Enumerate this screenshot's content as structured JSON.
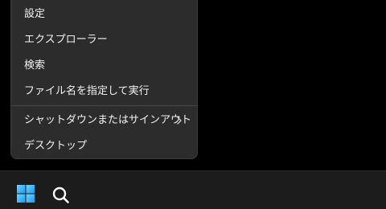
{
  "context_menu": {
    "items": [
      {
        "label": "設定"
      },
      {
        "label": "エクスプローラー"
      },
      {
        "label": "検索"
      },
      {
        "label": "ファイル名を指定して実行"
      },
      {
        "label": "シャットダウンまたはサインアウト",
        "has_submenu": true
      },
      {
        "label": "デスクトップ"
      }
    ]
  },
  "taskbar": {
    "buttons": [
      {
        "icon": "windows-start-icon"
      },
      {
        "icon": "search-icon"
      }
    ]
  },
  "colors": {
    "menu_background": "#2c2c2c",
    "menu_text": "#f2f2f2",
    "taskbar_background": "#1c1c1c",
    "start_icon": "#4cc2ff",
    "desktop_background": "#000000"
  }
}
